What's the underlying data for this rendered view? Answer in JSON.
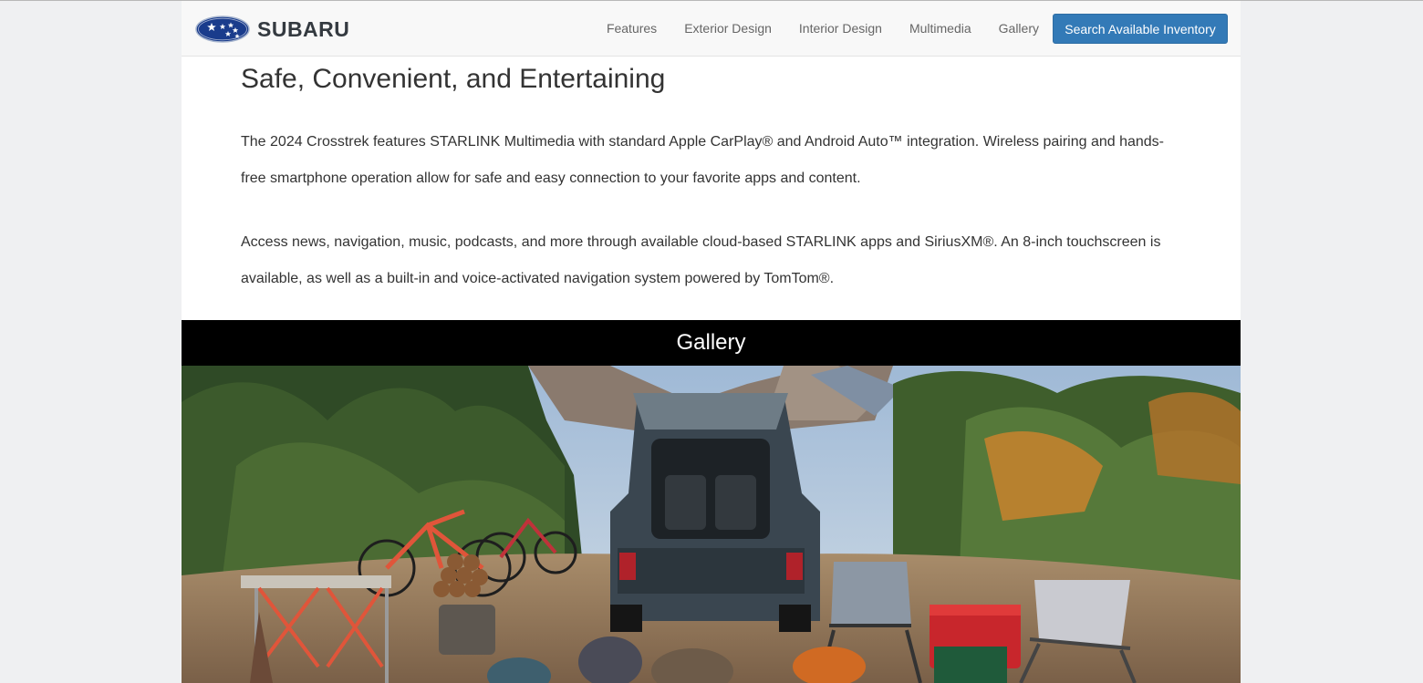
{
  "header": {
    "logo_text": "SUBARU",
    "nav": [
      {
        "label": "Features"
      },
      {
        "label": "Exterior Design"
      },
      {
        "label": "Interior Design"
      },
      {
        "label": "Multimedia"
      },
      {
        "label": "Gallery"
      }
    ],
    "cta_label": "Search Available Inventory"
  },
  "section": {
    "title": "Safe, Convenient, and Entertaining",
    "paragraphs": [
      "The 2024 Crosstrek features STARLINK Multimedia with standard Apple CarPlay® and Android Auto™ integration. Wireless pairing and hands-free smartphone operation allow for safe and easy connection to your favorite apps and content.",
      "Access news, navigation, music, podcasts, and more through available cloud-based STARLINK apps and SiriusXM®. An 8-inch touchscreen is available, as well as a built-in and voice-activated navigation system powered by TomTom®."
    ]
  },
  "gallery": {
    "title": "Gallery"
  },
  "colors": {
    "page_bg": "#eff0f2",
    "navbar_bg": "#f8f8f8",
    "cta_bg": "#337ab7",
    "band_bg": "#000000",
    "logo_blue": "#1a3c8c"
  },
  "icons": [
    "subaru-logo-icon"
  ]
}
